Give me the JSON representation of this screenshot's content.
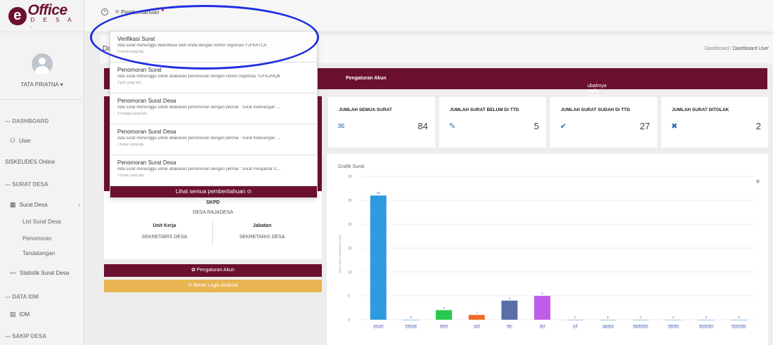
{
  "brand": {
    "logo_name": "Office",
    "logo_sub": "D E S A .",
    "logo_mark": "e",
    "color": "#6b1030"
  },
  "user": {
    "name": "TATA PRIATNA ▾"
  },
  "sidebar": {
    "sections": [
      {
        "label": "--- DASHBOARD"
      },
      {
        "label": "--- SURAT DESA"
      },
      {
        "label": "--- DATA IDM"
      },
      {
        "label": "--- SAKIP DESA"
      }
    ],
    "items": {
      "user": "User",
      "siskeudes": "SISKEUDES Online",
      "surat_desa": "Surat Desa",
      "list_surat": "List Surat Desa",
      "penomoran": "Penomoran",
      "tandatangan": "Tandatangan",
      "statistik": "Statistik Surat Desa",
      "idm": "IDM"
    }
  },
  "topbar": {
    "notif_label": "Pemberitahuan"
  },
  "page": {
    "title": "Da",
    "breadcrumb_root": "Dashboard /",
    "breadcrumb_current": "Dashboard User"
  },
  "alert": {
    "text_pre": "ubahnya pada menu ",
    "text_bold": "Pengaturan Akun"
  },
  "notifications": [
    {
      "title": "Verifikasi Surat",
      "body": "Ada surat menunggu diverifikasi oleh Anda dengan nomor registrasi YJFKNTC4",
      "time": "8 menit yang lalu"
    },
    {
      "title": "Penomoran Surat",
      "body": "Ada surat menunggu untuk dilakukan penomoran dengan nomor registrasi YZFKZMQB",
      "time": "3 jam yang lalu"
    },
    {
      "title": "Penomoran Surat Desa",
      "body": "Ada surat menunggu untuk dilakukan penomoran dengan perihal : Surat Keterangan ...",
      "time": "2 minggu yang lalu"
    },
    {
      "title": "Penomoran Surat Desa",
      "body": "Ada surat menunggu untuk dilakukan penomoran dengan perihal : Surat Keterangan ...",
      "time": "1 bulan yang lalu"
    },
    {
      "title": "Penomoran Surat Desa",
      "body": "Ada surat menunggu untuk dilakukan penomoran dengan perihal : Surat Pengantar C...",
      "time": "3 bulan yang lalu"
    }
  ],
  "notif_footer": "Lihat semua pemberitahuan ⊙",
  "profile": {
    "skpd_label": "SKPD",
    "skpd_value": "DESA RAJADESA",
    "unit_label": "Unit Kerja",
    "unit_value": "SEKRETARIS DESA",
    "jabatan_label": "Jabatan",
    "jabatan_value": "SEKRETARIS DESA"
  },
  "buttons": {
    "akun": "✿ Pengaturan Akun",
    "reset": "⟳ Reset Login Android"
  },
  "stats": [
    {
      "title": "JUMLAH SEMUA SURAT",
      "value": "84",
      "icon": "✉"
    },
    {
      "title": "JUMLAH SURAT BELUM DI TTD",
      "value": "5",
      "icon": "✎"
    },
    {
      "title": "JUMLAH SURAT SUDAH DI TTD",
      "value": "27",
      "icon": "✔"
    },
    {
      "title": "JUMLAH SURAT DITOLAK",
      "value": "2",
      "icon": "✖"
    }
  ],
  "chart_title": "Grafik Surat",
  "chart_data": {
    "type": "bar",
    "title": "Grafik Surat",
    "ylabel": "Total Jumlah Pembuatan Surat",
    "ylim": [
      0,
      30
    ],
    "yticks": [
      "0",
      "5",
      "10",
      "15",
      "20",
      "25",
      "30"
    ],
    "categories": [
      "Januari",
      "Februari",
      "Maret",
      "April",
      "Mei",
      "Juni",
      "Juli",
      "Agustus",
      "September",
      "Oktober",
      "November",
      "Desember"
    ],
    "values": [
      26,
      0,
      2,
      1,
      4,
      5,
      0,
      0,
      0,
      0,
      0,
      0
    ],
    "colors": [
      "#2e9be0",
      "#2e9be0",
      "#27c94e",
      "#f06a2a",
      "#5a6fa8",
      "#c05ce8",
      "#2e9be0",
      "#2e9be0",
      "#2e9be0",
      "#2e9be0",
      "#2e9be0",
      "#2e9be0"
    ]
  }
}
